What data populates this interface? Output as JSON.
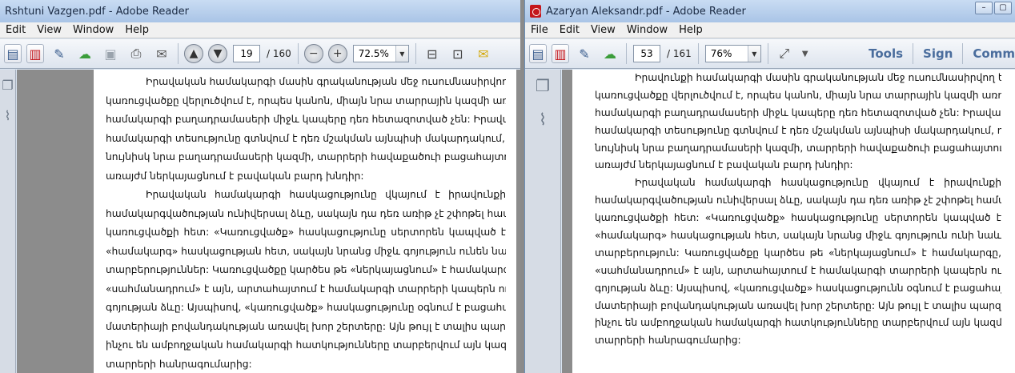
{
  "left_window": {
    "title": "Rshtuni Vazgen.pdf - Adobe Reader",
    "menu": [
      "Edit",
      "View",
      "Window",
      "Help"
    ],
    "page_current": "19",
    "page_total": "/ 160",
    "zoom": "72.5%",
    "lines": [
      "Իրավական համակարգի մասին գրականության մեջ ուսումնասիրվող երևույթի",
      "կառուցվածքը վերլուծվում է, որպես կանոն, միայն նրա տարրային կազմի առումով.",
      "համակարգի բաղադրամասերի միջև կապերը դեռ հետազոտված չեն: Իրավական",
      "համակարգի տեսությունը գտնվում է դեռ մշակման այնպիսի մակարդակում, որ",
      "նույնիսկ նրա բաղադրամասերի կազմի, տարրերի հավաքածուի բացահայտումը",
      "առայժմ ներկայացնում է բավական բարդ խնդիր:",
      "Իրավական համակարգի հասկացությունը վկայում է իրավունքի",
      "համակարգվածության ունիվերսալ ձևը, սակայն դա դեռ առիթ չէ շփոթել համակարգը",
      "կառուցվածքի հետ: «Կառուցվածք» հասկացությունը սերտորեն կապված է",
      "«համակարգ» հասկացության հետ, սակայն նրանց միջև գոյություն ունեն նաև",
      "տարբերություններ: Կառուցվածքը կարծես թե «ներկայացնում» է համակարգը,",
      "«սահմանադրում» է այն, արտահայտում է համակարգի տարրերի կապերն ու",
      "գոյության ձևը: Այսպիսով, «կառուցվածք» հասկացությունը օգնում է բացահայտել",
      "մատերիայի բովանդակության առավել խոր շերտերը: Այն թույլ է տալիս պարզել, թե",
      "ինչու են ամբողջական համակարգի հատկությունները տարբերվում այն կազմող",
      "տարրերի հանրագումարից:"
    ]
  },
  "right_window": {
    "title": "Azaryan Aleksandr.pdf - Adobe Reader",
    "menu": [
      "File",
      "Edit",
      "View",
      "Window",
      "Help"
    ],
    "page_current": "53",
    "page_total": "/ 161",
    "zoom": "76%",
    "toolbar_links": [
      "Tools",
      "Sign",
      "Comm"
    ],
    "lines": [
      "Իրավունքի համակարգի մասին գրականության մեջ ուսումնասիրվող երևույթի",
      "կառուցվածքը վերլուծվում է, որպես կանոն, միայն նրա տարրային կազմի առումով,",
      "համակարգի բաղադրամասերի միջև կապերը դեռ հետազոտված չեն: Իրավական",
      "համակարգի տեսությունը գտնվում է դեռ մշակման այնպիսի մակարդակում, որ",
      "նույնիսկ նրա բաղադրամասերի կազմի, տարրերի հավաքածուի բացահայտումը",
      "առայժմ ներկայացնում է բավական բարդ խնդիր:",
      "Իրավական համակարգի հասկացությունը վկայում է իրավունքի",
      "համակարգվածության ունիվերսալ ձևը, սակայն դա դեռ առիթ չէ շփոթել համակարգը",
      "կառուցվածքի հետ: «Կառուցվածք» հասկացությունը սերտորեն կապված է",
      "«համակարգ» հասկացության հետ, սակայն նրանց միջև գոյություն ունի նաև",
      "տարբերություն: Կառուցվածքը կարծես թե «ներկայացնում» է համակարգը,",
      "«սահմանադրում» է այն, արտահայտում է համակարգի տարրերի կապերն ու",
      "գոյության ձևը: Այսպիսով, «կառուցվածք» հասկացությունն օգնում է բացահայտել",
      "մատերիայի բովանդակության առավել խոր շերտերը: Այն թույլ է տալիս պարզել, թե",
      "ինչու են ամբողջական համակարգի հատկությունները տարբերվում այն կազմող",
      "տարրերի հանրագումարից:"
    ]
  }
}
